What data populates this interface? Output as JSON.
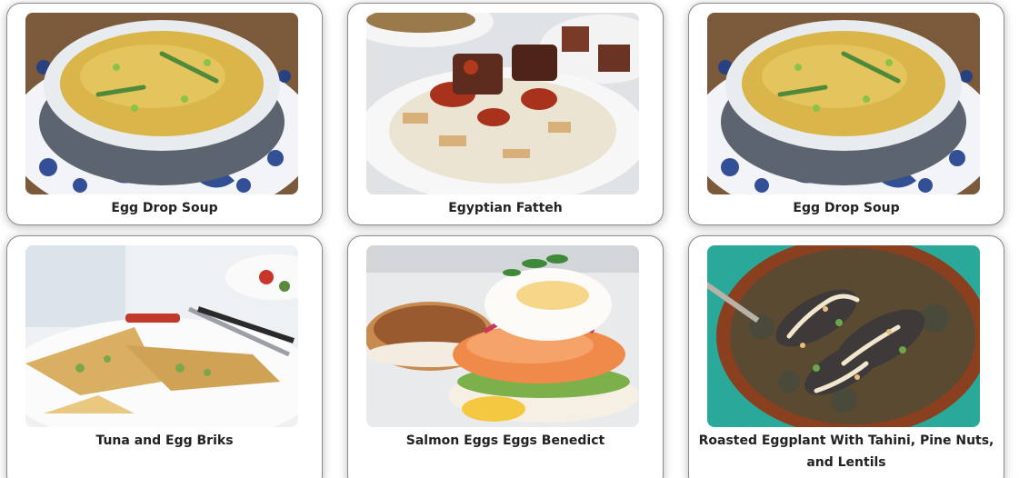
{
  "recipes": [
    {
      "title": "Egg Drop Soup",
      "image": "egg-drop-soup-photo"
    },
    {
      "title": "Egyptian Fatteh",
      "image": "egyptian-fatteh-photo"
    },
    {
      "title": "Egg Drop Soup",
      "image": "egg-drop-soup-photo"
    },
    {
      "title": "Tuna and Egg Briks",
      "image": "tuna-egg-briks-photo"
    },
    {
      "title": "Salmon Eggs Eggs Benedict",
      "image": "salmon-eggs-benedict-photo"
    },
    {
      "title": "Roasted Eggplant With Tahini, Pine Nuts, and Lentils",
      "image": "roasted-eggplant-photo"
    }
  ]
}
